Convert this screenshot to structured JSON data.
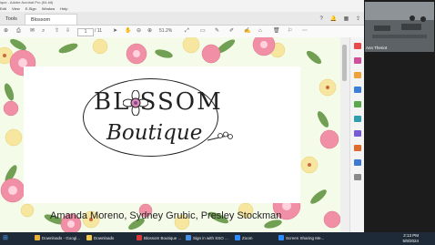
{
  "window": {
    "title": "ique - Adobe Acrobat Pro (64-bit)",
    "menu": [
      "Edit",
      "View",
      "E-Sign",
      "Window",
      "Help"
    ]
  },
  "tabs": {
    "tools": "Tools",
    "document": "Blossom Boutique"
  },
  "toolbar": {
    "page_current": "1",
    "page_total": "/ 11",
    "zoom": "51.2%"
  },
  "slide": {
    "logo_line1": "BL SSOM",
    "logo_line2": "Boutique",
    "authors": "Amanda Moreno, Sydney Grubic, Presley Stockman",
    "colors": {
      "background": "#f5fbe9",
      "pink": "#f08fa6",
      "yellow": "#f6e6a0",
      "leaf": "#5b8f3a"
    }
  },
  "zoom": {
    "participant_name": "Ann Theriot"
  },
  "taskbar": {
    "items": [
      "Downloads - Googl...",
      "Downloads",
      "Blossom Boutique ...",
      "Sign in with SSO ...",
      "Zoom",
      "Screen Sharing Me..."
    ],
    "time": "2:13 PM",
    "date": "5/9/2024"
  }
}
